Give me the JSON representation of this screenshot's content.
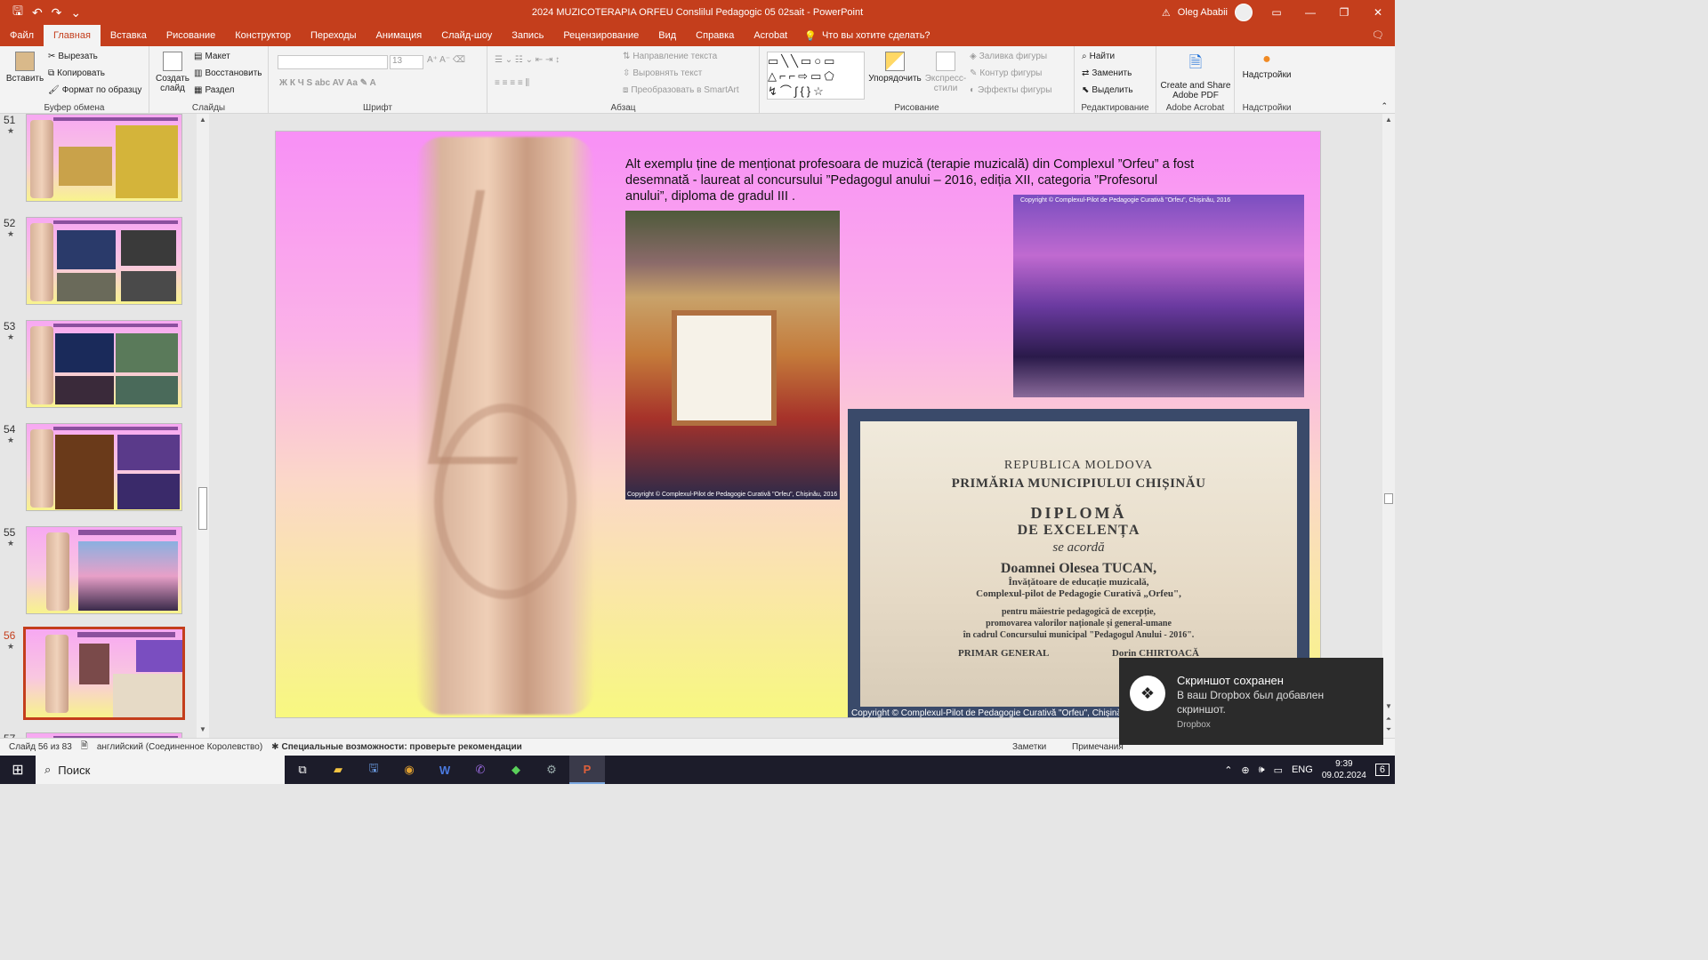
{
  "titlebar": {
    "doc_title": "2024 MUZICOTERAPIA ORFEU Conslilul Pedagogic 05 02sait - PowerPoint",
    "user_name": "Oleg Ababii",
    "save_icon": "save-icon",
    "undo_icon": "undo-icon",
    "redo_icon": "redo-icon"
  },
  "tabs": [
    {
      "label": "Файл"
    },
    {
      "label": "Главная"
    },
    {
      "label": "Вставка"
    },
    {
      "label": "Рисование"
    },
    {
      "label": "Конструктор"
    },
    {
      "label": "Переходы"
    },
    {
      "label": "Анимация"
    },
    {
      "label": "Слайд-шоу"
    },
    {
      "label": "Запись"
    },
    {
      "label": "Рецензирование"
    },
    {
      "label": "Вид"
    },
    {
      "label": "Справка"
    },
    {
      "label": "Acrobat"
    }
  ],
  "tell_me": "Что вы хотите сделать?",
  "ribbon": {
    "clipboard": {
      "paste": "Вставить",
      "cut": "Вырезать",
      "copy": "Копировать",
      "format": "Формат по образцу",
      "label": "Буфер обмена"
    },
    "slides": {
      "new_slide": "Создать слайд",
      "layout": "Макет",
      "reset": "Восстановить",
      "section": "Раздел",
      "label": "Слайды"
    },
    "font": {
      "size": "13",
      "label": "Шрифт"
    },
    "paragraph": {
      "direction": "Направление текста",
      "align": "Выровнять текст",
      "smartart": "Преобразовать в SmartArt",
      "label": "Абзац"
    },
    "drawing": {
      "arrange": "Упорядочить",
      "styles": "Экспресс-стили",
      "fill": "Заливка фигуры",
      "outline": "Контур фигуры",
      "effects": "Эффекты фигуры",
      "label": "Рисование"
    },
    "editing": {
      "find": "Найти",
      "replace": "Заменить",
      "select": "Выделить",
      "label": "Редактирование"
    },
    "acrobat": {
      "create_share": "Create and Share Adobe PDF",
      "label": "Adobe Acrobat"
    },
    "addins": {
      "addins": "Надстройки",
      "label": "Надстройки"
    }
  },
  "thumbnails": [
    {
      "num": "51",
      "star": "★"
    },
    {
      "num": "52",
      "star": "★"
    },
    {
      "num": "53",
      "star": "★"
    },
    {
      "num": "54",
      "star": "★"
    },
    {
      "num": "55",
      "star": "★"
    },
    {
      "num": "56",
      "star": "★"
    },
    {
      "num": "57",
      "star": ""
    }
  ],
  "slide": {
    "text": "Alt exemplu ține de menționat  profesoara de muzică (terapie muzicală) din Complexul ”Orfeu” a fost desemnată - laureat al concursului ”Pedagogul anului – 2016, ediția XII, categoria ”Profesorul anului”, diploma de gradul III .",
    "caption1": "Copyright © Complexul-Pilot de Pedagogie Curativă \"Orfeu\", Chișinău, 2016",
    "caption2": "Copyright © Complexul-Pilot de Pedagogie Curativă \"Orfeu\", Chișinău, 2016",
    "caption3": "Copyright © Complexul-Pilot de Pedagogie Curativă \"Orfeu\", Chișinău, 2016",
    "diploma": {
      "l1": "REPUBLICA MOLDOVA",
      "l2": "PRIMĂRIA MUNICIPIULUI CHIȘINĂU",
      "l3": "DIPLOMĂ",
      "l4": "DE EXCELENȚA",
      "l5": "se acordă",
      "l6": "Doamnei Olesea TUCAN,",
      "l7a": "Învățătoare de educație muzicală,",
      "l7b": "Complexul-pilot de Pedagogie Curativă „Orfeu\",",
      "l8a": "pentru  măiestrie pedagogică de excepție,",
      "l8b": "promovarea  valorilor  naționale și general-umane",
      "l8c": "în cadrul Concursului municipal \"Pedagogul Anului - 2016\".",
      "sign_left": "PRIMAR GENERAL",
      "sign_right": "Dorin CHIRTOACĂ"
    }
  },
  "statusbar": {
    "slide_of": "Слайд 56 из 83",
    "language": "английский (Соединенное Королевство)",
    "accessibility": "Специальные возможности: проверьте рекомендации",
    "notes": "Заметки",
    "comments": "Примечания"
  },
  "taskbar": {
    "search": "Поиск",
    "lang": "ENG",
    "time": "9:39",
    "date": "09.02.2024",
    "notif_count": "6"
  },
  "toast": {
    "title": "Скриншот сохранен",
    "body": "В ваш Dropbox был добавлен скриншот.",
    "source": "Dropbox"
  },
  "colors": {
    "accent": "#c43e1c",
    "slide_top": "#f890f6",
    "slide_bottom": "#f8f880"
  }
}
